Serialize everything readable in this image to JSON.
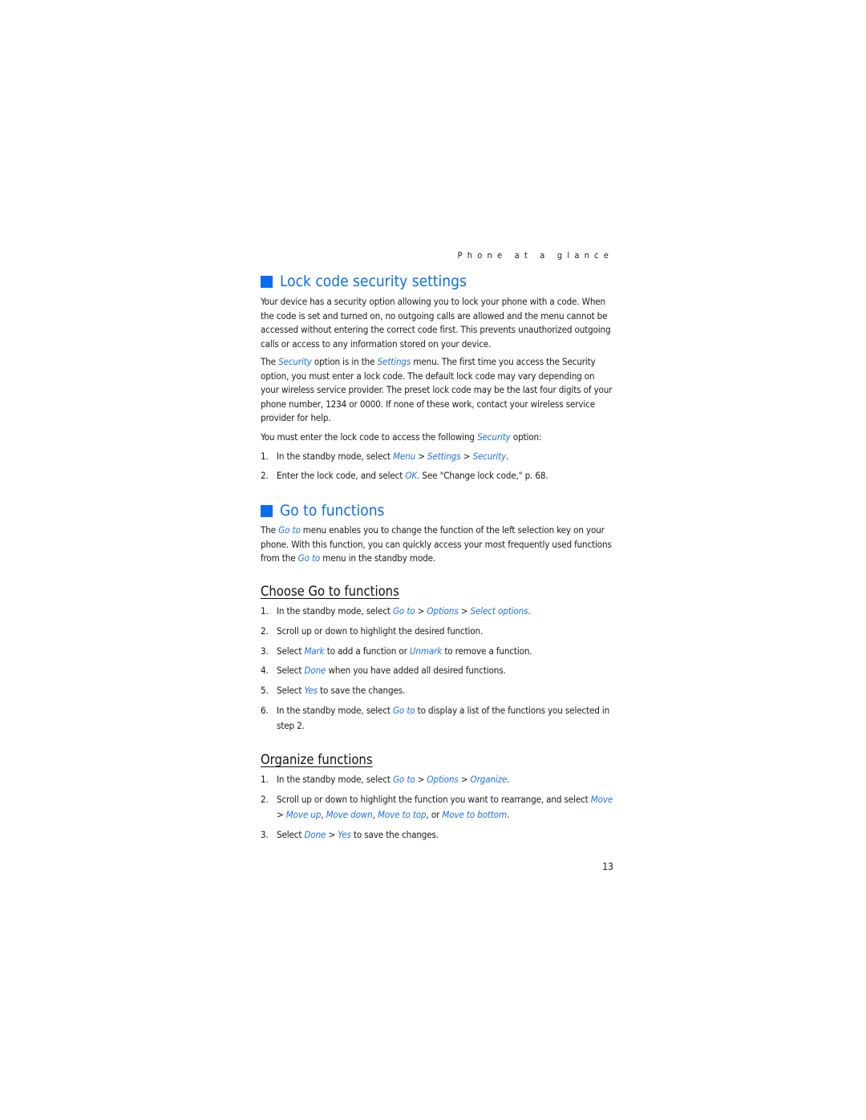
{
  "running_head": "Phone at a glance",
  "page_number": "13",
  "accent_color": "#0a6cf0",
  "sections": {
    "lock": {
      "title": "Lock code security settings",
      "p1": "Your device has a security option allowing you to lock your phone with a code. When the code is set and turned on, no outgoing calls are allowed and the menu cannot be accessed without entering the correct code first. This prevents unauthorized outgoing calls or access to any information stored on your device.",
      "p2": [
        {
          "t": "The "
        },
        {
          "t": "Security",
          "link": true
        },
        {
          "t": " option is in the "
        },
        {
          "t": "Settings",
          "link": true
        },
        {
          "t": " menu. The first time you access the Security option, you must enter a lock code. The default lock code may vary depending on your wireless service provider. The preset lock code may be the last four digits of your phone number, 1234 or 0000. If none of these work, contact your wireless service provider for help."
        }
      ],
      "p3": [
        {
          "t": "You must enter the lock code to access the following "
        },
        {
          "t": "Security",
          "link": true
        },
        {
          "t": " option:"
        }
      ],
      "steps": [
        [
          {
            "t": "In the standby mode, select "
          },
          {
            "t": "Menu",
            "link": true
          },
          {
            "t": " > "
          },
          {
            "t": "Settings",
            "link": true
          },
          {
            "t": " > "
          },
          {
            "t": "Security",
            "link": true
          },
          {
            "t": "."
          }
        ],
        [
          {
            "t": "Enter the lock code, and select "
          },
          {
            "t": "OK",
            "link": true
          },
          {
            "t": ". See \"Change lock code,\" p. 68."
          }
        ]
      ]
    },
    "goto": {
      "title": "Go to functions",
      "p1": [
        {
          "t": "The "
        },
        {
          "t": "Go to",
          "link": true
        },
        {
          "t": " menu enables you to change the function of the left selection key on your phone. With this function, you can quickly access your most frequently used functions from the "
        },
        {
          "t": "Go to",
          "link": true
        },
        {
          "t": " menu in the standby mode."
        }
      ]
    },
    "choose": {
      "title": "Choose Go to functions",
      "steps": [
        [
          {
            "t": "In the standby mode, select "
          },
          {
            "t": "Go to",
            "link": true
          },
          {
            "t": " > "
          },
          {
            "t": "Options",
            "link": true
          },
          {
            "t": " > "
          },
          {
            "t": "Select options",
            "link": true
          },
          {
            "t": "."
          }
        ],
        [
          {
            "t": "Scroll up or down to highlight the desired function."
          }
        ],
        [
          {
            "t": "Select "
          },
          {
            "t": "Mark",
            "link": true
          },
          {
            "t": " to add a function or "
          },
          {
            "t": "Unmark",
            "link": true
          },
          {
            "t": " to remove a function."
          }
        ],
        [
          {
            "t": "Select "
          },
          {
            "t": "Done",
            "link": true
          },
          {
            "t": " when you have added all desired functions."
          }
        ],
        [
          {
            "t": "Select "
          },
          {
            "t": "Yes",
            "link": true
          },
          {
            "t": " to save the changes."
          }
        ],
        [
          {
            "t": "In the standby mode, select "
          },
          {
            "t": "Go to",
            "link": true
          },
          {
            "t": " to display a list of the functions you selected in step 2."
          }
        ]
      ]
    },
    "organize": {
      "title": "Organize functions",
      "steps": [
        [
          {
            "t": "In the standby mode, select "
          },
          {
            "t": "Go to",
            "link": true
          },
          {
            "t": " > "
          },
          {
            "t": "Options",
            "link": true
          },
          {
            "t": " > "
          },
          {
            "t": "Organize",
            "link": true
          },
          {
            "t": "."
          }
        ],
        [
          {
            "t": "Scroll up or down to highlight the function you want to rearrange, and select "
          },
          {
            "t": "Move",
            "link": true
          },
          {
            "t": " > "
          },
          {
            "t": "Move up",
            "link": true
          },
          {
            "t": ", "
          },
          {
            "t": "Move down",
            "link": true
          },
          {
            "t": ", "
          },
          {
            "t": "Move to top",
            "link": true
          },
          {
            "t": ", or "
          },
          {
            "t": "Move to bottom",
            "link": true
          },
          {
            "t": "."
          }
        ],
        [
          {
            "t": "Select "
          },
          {
            "t": "Done",
            "link": true
          },
          {
            "t": " > "
          },
          {
            "t": "Yes",
            "link": true
          },
          {
            "t": " to save the changes."
          }
        ]
      ]
    }
  }
}
